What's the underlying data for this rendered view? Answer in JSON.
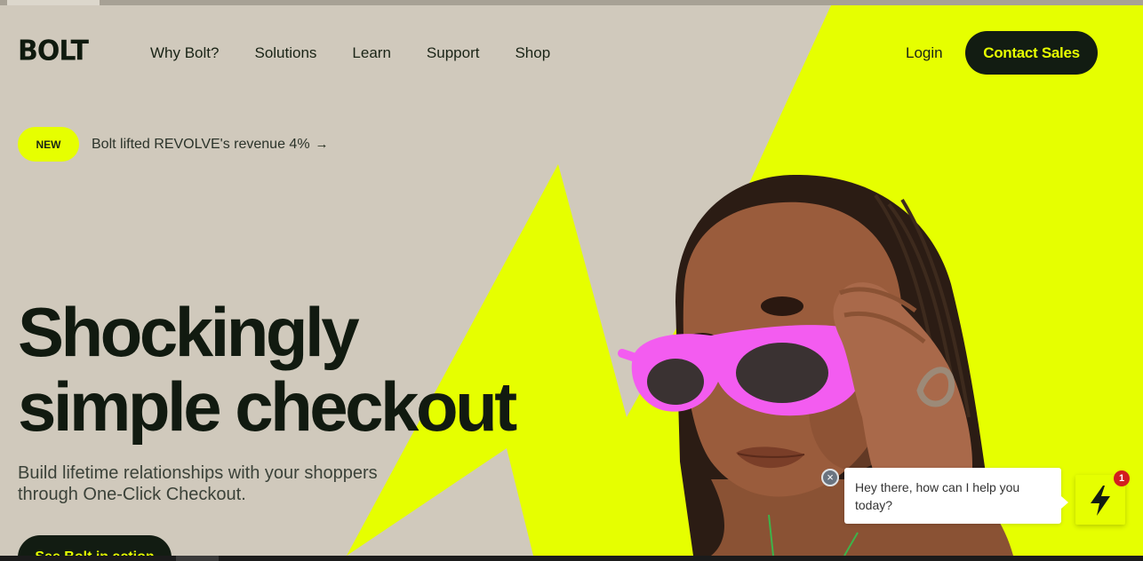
{
  "header": {
    "logo": "BOLT",
    "nav": [
      "Why Bolt?",
      "Solutions",
      "Learn",
      "Support",
      "Shop"
    ],
    "login": "Login",
    "contact": "Contact Sales"
  },
  "announcement": {
    "badge": "NEW",
    "text": "Bolt lifted REVOLVE's revenue 4%",
    "arrow": "→"
  },
  "hero": {
    "headline_line1": "Shockingly",
    "headline_line2": "simple checkout",
    "subheadline_line1": "Build lifetime relationships with your shoppers",
    "subheadline_line2": "through One-Click Checkout.",
    "cta": "See Bolt in action"
  },
  "chat": {
    "close": "×",
    "message": "Hey there, how can I help you today?",
    "unread_count": "1"
  },
  "colors": {
    "accent": "#e6ff00",
    "background": "#d0c9bc",
    "dark": "#121c12"
  }
}
